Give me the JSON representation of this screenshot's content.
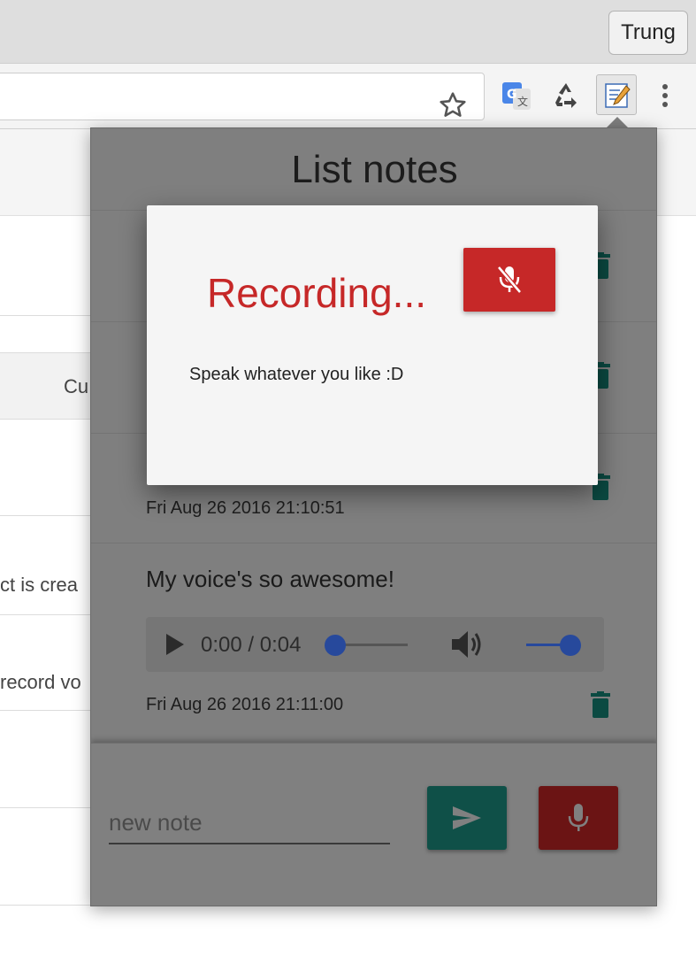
{
  "browser": {
    "profile_name": "Trung",
    "icons": [
      "star-icon",
      "google-translate-icon",
      "recycle-icon",
      "notes-extension-icon",
      "menu-dots-icon"
    ]
  },
  "background_page": {
    "column_fragment": "Cu",
    "row_fragment_1": "ct is crea",
    "row_fragment_2": "record vo"
  },
  "popup": {
    "title": "List notes",
    "notes": [
      {
        "date": "Fri Aug 26 2016 21:10:51"
      },
      {
        "text": "My voice's so awesome!",
        "audio": {
          "time": "0:00 / 0:04",
          "progress": 0,
          "volume": 1
        },
        "date": "Fri Aug 26 2016 21:11:00"
      }
    ],
    "input": {
      "placeholder": "new note",
      "value": ""
    }
  },
  "modal": {
    "title": "Recording...",
    "hint": "Speak whatever you like :D"
  },
  "colors": {
    "recording_red": "#c62828",
    "send_green": "#00796b",
    "trash_green": "#00695c",
    "slider_blue": "#27499c"
  }
}
